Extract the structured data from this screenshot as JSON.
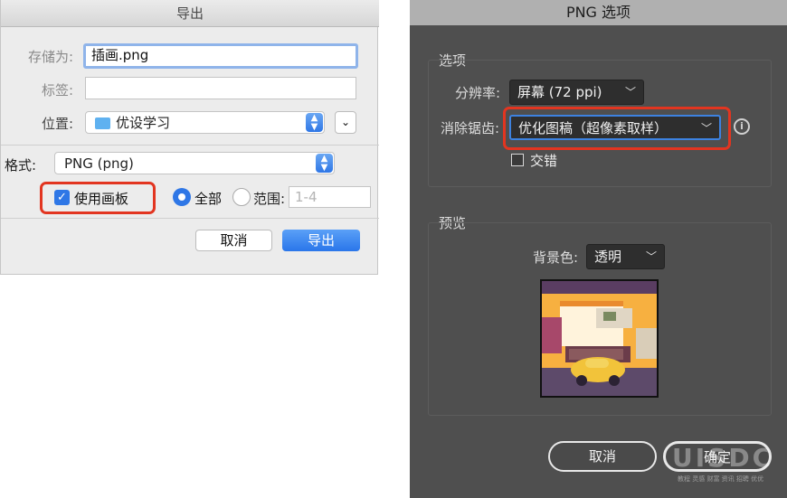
{
  "export_dialog": {
    "title": "导出",
    "save_as_label": "存储为:",
    "save_as_value": "插画.png",
    "tags_label": "标签:",
    "tags_value": "",
    "location_label": "位置:",
    "location_value": "优设学习",
    "format_label": "格式:",
    "format_value": "PNG (png)",
    "use_artboards_label": "使用画板",
    "use_artboards_checked": true,
    "all_label": "全部",
    "range_label": "范围:",
    "range_placeholder": "1-4",
    "cancel_label": "取消",
    "export_label": "导出"
  },
  "png_options": {
    "title": "PNG 选项",
    "options_group_label": "选项",
    "resolution_label": "分辨率:",
    "resolution_value": "屏幕 (72 ppi)",
    "antialias_label": "消除锯齿:",
    "antialias_value": "优化图稿（超像素取样）",
    "interlaced_label": "交错",
    "interlaced_checked": false,
    "preview_group_label": "预览",
    "background_label": "背景色:",
    "background_value": "透明",
    "cancel_label": "取消",
    "ok_label": "确定"
  },
  "watermark": {
    "logo_text": "UISDC",
    "tagline": "教程 灵感 财富 资讯 招聘 优优"
  },
  "colors": {
    "accent_blue": "#2f77e6",
    "highlight_red": "#e23520",
    "dark_panel": "#4f4f4f"
  }
}
